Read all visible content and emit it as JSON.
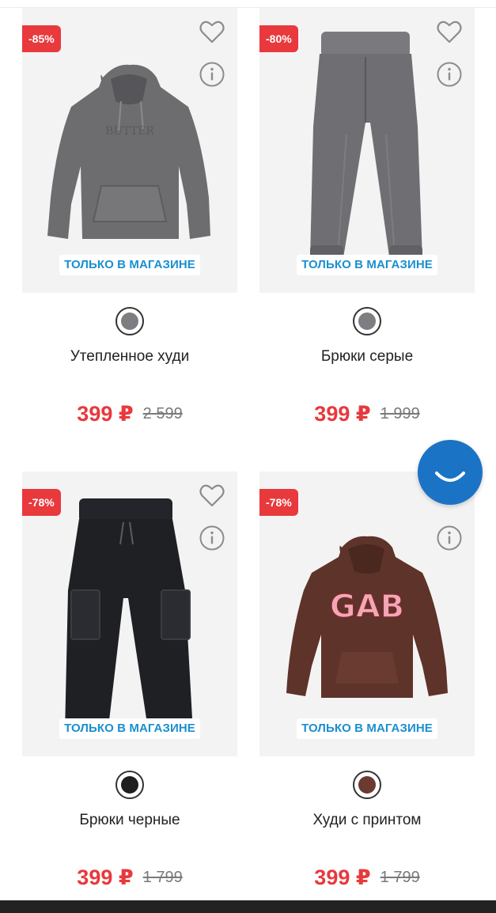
{
  "products": [
    {
      "discount": "-85%",
      "store_label": "ТОЛЬКО В МАГАЗИНЕ",
      "name": "Утепленное худи",
      "price": "399 ₽",
      "old_price": "2 599",
      "color": "#7d7d82",
      "image": "gray-hoodie-image"
    },
    {
      "discount": "-80%",
      "store_label": "ТОЛЬКО В МАГАЗИНЕ",
      "name": "Брюки серые",
      "price": "399 ₽",
      "old_price": "1 999",
      "color": "#7d7d82",
      "image": "gray-pants-image"
    },
    {
      "discount": "-78%",
      "store_label": "ТОЛЬКО В МАГАЗИНЕ",
      "name": "Брюки черные",
      "price": "399 ₽",
      "old_price": "1 799",
      "color": "#1f1f22",
      "image": "black-cargo-pants-image"
    },
    {
      "discount": "-78%",
      "store_label": "ТОЛЬКО В МАГАЗИНЕ",
      "name": "Худи с принтом",
      "price": "399 ₽",
      "old_price": "1 799",
      "color": "#6b3a30",
      "image": "brown-print-hoodie-image"
    }
  ],
  "icons": {
    "favorite": "heart-icon",
    "info": "info-icon",
    "chat": "chat-smile-icon"
  },
  "colors": {
    "discount_badge": "#e8393d",
    "price": "#e8393d",
    "store_label": "#1a8fcf",
    "chat_button": "#1b73c5"
  }
}
